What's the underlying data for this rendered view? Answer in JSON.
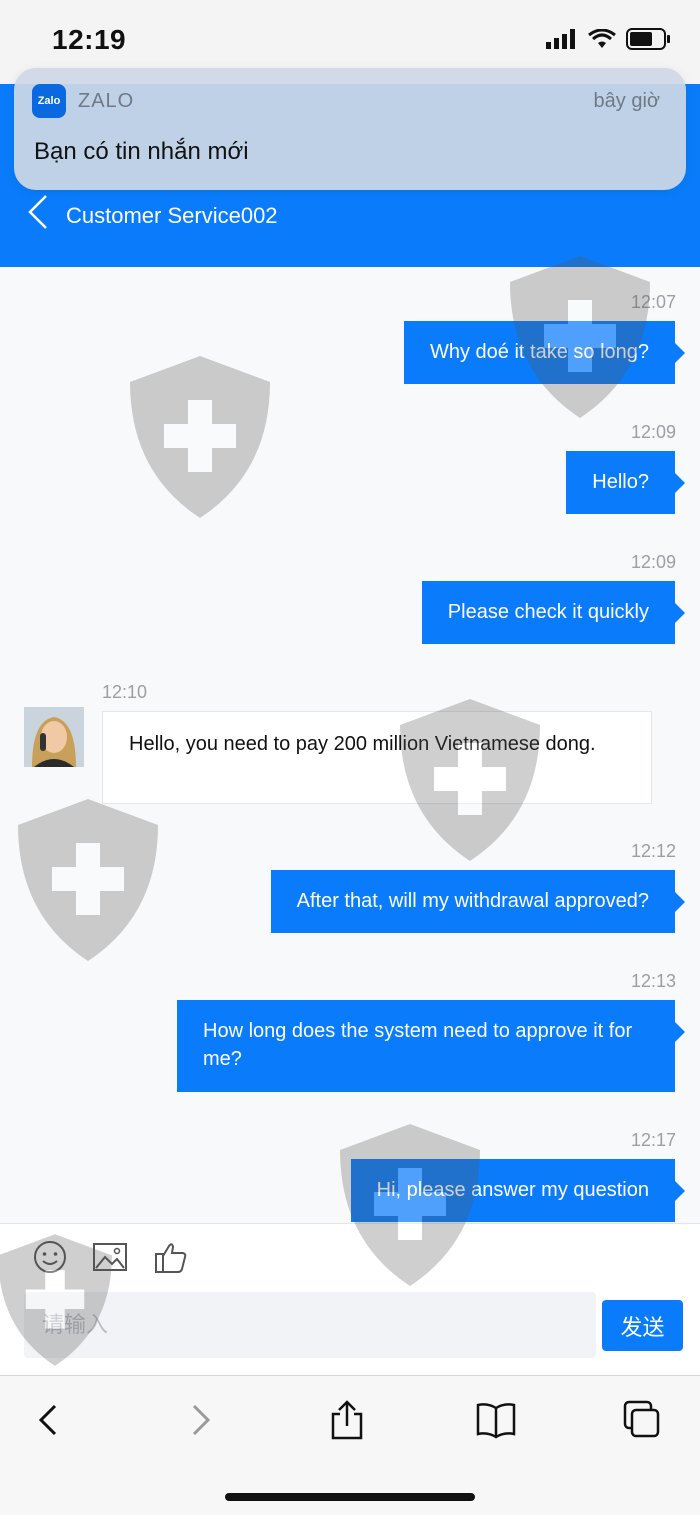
{
  "status_bar": {
    "time": "12:19"
  },
  "notification": {
    "app_name": "ZALO",
    "icon_text": "Zalo",
    "time": "bây giờ",
    "message": "Bạn có tin nhắn mới"
  },
  "header": {
    "title": "Customer Service002"
  },
  "messages": [
    {
      "time": "12:07",
      "text": "Why doé it take so long?"
    },
    {
      "time": "12:09",
      "text": "Hello?"
    },
    {
      "time": "12:09",
      "text": "Please check it quickly"
    },
    {
      "time": "12:10",
      "text": "Hello, you need to pay 200 million Vietnamese dong."
    },
    {
      "time": "12:12",
      "text": "After that, will my withdrawal approved?"
    },
    {
      "time": "12:13",
      "text": "How long does the system need to approve it for me?"
    },
    {
      "time": "12:17",
      "text": "Hi, please answer my question"
    }
  ],
  "composer": {
    "placeholder": "请输入",
    "send_label": "发送"
  },
  "colors": {
    "accent": "#0a7cfb",
    "header": "#0a7cfb"
  }
}
